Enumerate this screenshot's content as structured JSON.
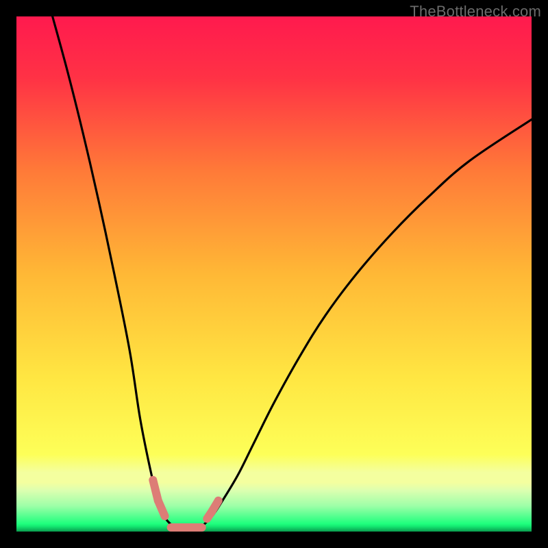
{
  "watermark": "TheBottleneck.com",
  "chart_data": {
    "type": "line",
    "title": "",
    "xlabel": "",
    "ylabel": "",
    "xlim": [
      0,
      100
    ],
    "ylim": [
      0,
      100
    ],
    "grid": false,
    "legend": false,
    "background_gradient": {
      "top_color": "#ff1a4e",
      "mid_color": "#ffe742",
      "green_band_top": "#f4ff9f",
      "green_band_bottom": "#1fff7d"
    },
    "series": [
      {
        "name": "left-curve",
        "stroke": "#000000",
        "x": [
          7,
          10,
          13,
          16,
          19,
          22,
          24,
          26,
          27.5,
          29,
          30.5
        ],
        "values": [
          100,
          89,
          77,
          64,
          50,
          35,
          22,
          12,
          6,
          2.5,
          1
        ]
      },
      {
        "name": "right-curve",
        "stroke": "#000000",
        "x": [
          36,
          38,
          40,
          43,
          46,
          50,
          55,
          60,
          66,
          73,
          80,
          88,
          100
        ],
        "values": [
          1,
          3,
          6,
          11,
          17,
          25,
          34,
          42,
          50,
          58,
          65,
          72,
          80
        ]
      },
      {
        "name": "segments-salmon",
        "stroke": "#dd7d76",
        "segments": [
          {
            "x": [
              26.5,
              27.5
            ],
            "values": [
              10,
              6
            ]
          },
          {
            "x": [
              27.5,
              28.8
            ],
            "values": [
              6,
              3
            ]
          },
          {
            "x": [
              30,
              36
            ],
            "values": [
              0.8,
              0.8
            ]
          },
          {
            "x": [
              37,
              38
            ],
            "values": [
              2.5,
              4
            ]
          },
          {
            "x": [
              38,
              39.2
            ],
            "values": [
              4,
              6
            ]
          }
        ]
      }
    ]
  }
}
